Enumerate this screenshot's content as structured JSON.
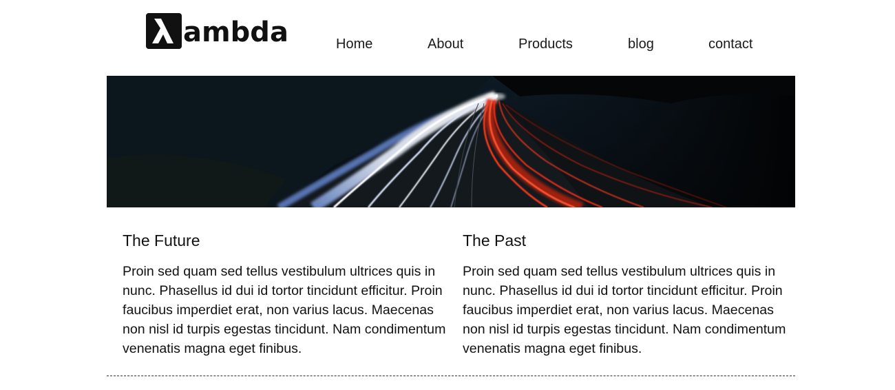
{
  "brand": {
    "logo_glyph": "λ",
    "logo_text": "ambda"
  },
  "nav": {
    "items": [
      {
        "label": "Home"
      },
      {
        "label": "About"
      },
      {
        "label": "Products"
      },
      {
        "label": "blog"
      },
      {
        "label": "contact"
      }
    ]
  },
  "hero": {
    "image_subject": "long-exposure highway light trails at night"
  },
  "sections": [
    {
      "title": "The Future",
      "body": "Proin sed quam sed tellus vestibulum ultrices quis in nunc. Phasellus id dui id tortor tincidunt efficitur. Proin faucibus imperdiet erat, non varius lacus. Maecenas non nisl id turpis egestas tincidunt. Nam condimentum venenatis magna eget finibus."
    },
    {
      "title": "The Past",
      "body": "Proin sed quam sed tellus vestibulum ultrices quis in nunc. Phasellus id dui id tortor tincidunt efficitur. Proin faucibus imperdiet erat, non varius lacus. Maecenas non nisl id turpis egestas tincidunt. Nam condimentum venenatis magna eget finibus."
    }
  ],
  "colors": {
    "text": "#111111",
    "background": "#ffffff",
    "light_trail_white": "#e8f0ff",
    "light_trail_red": "#ff3b1f"
  }
}
